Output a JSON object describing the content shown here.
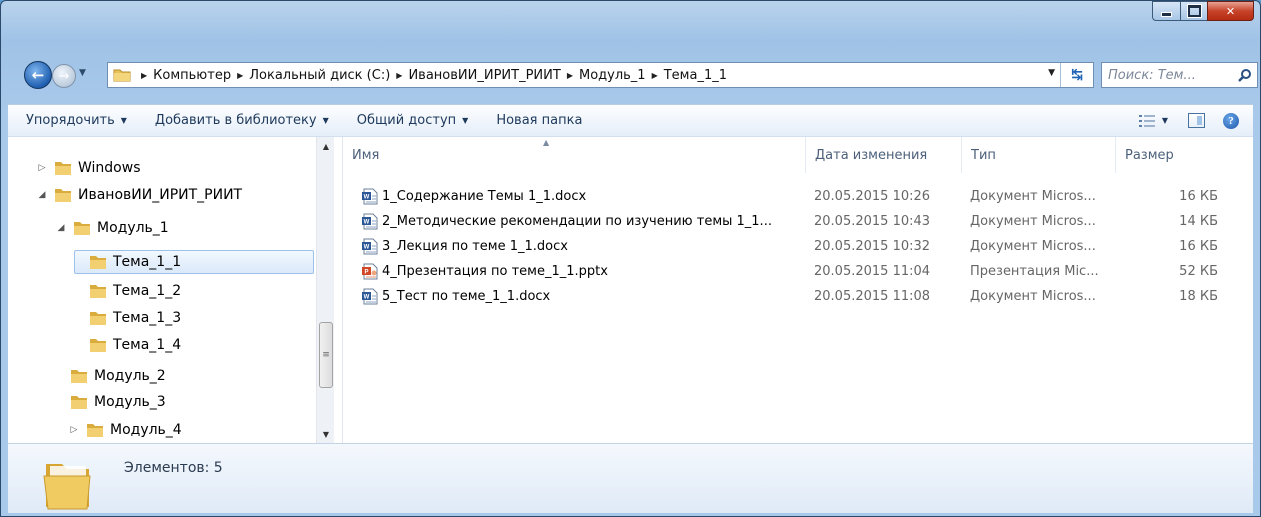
{
  "window": {
    "caption_buttons": {
      "minimize": "minimize",
      "maximize": "maximize",
      "close": "close"
    }
  },
  "address_bar": {
    "breadcrumbs": [
      "Компьютер",
      "Локальный диск (C:)",
      "ИвановИИ_ИРИТ_РИИТ",
      "Модуль_1",
      "Тема_1_1"
    ]
  },
  "search": {
    "placeholder": "Поиск: Тем..."
  },
  "toolbar": {
    "organize": "Упорядочить",
    "add_to_library": "Добавить в библиотеку",
    "share": "Общий доступ",
    "new_folder": "Новая папка"
  },
  "nav_tree": [
    {
      "label": "Windows",
      "expander": "▷"
    },
    {
      "label": "ИвановИИ_ИРИТ_РИИТ",
      "expander": "◢"
    },
    {
      "label": "Модуль_1",
      "expander": "◢"
    },
    {
      "label": "Тема_1_1",
      "expander": "",
      "selected": true
    },
    {
      "label": "Тема_1_2",
      "expander": ""
    },
    {
      "label": "Тема_1_3",
      "expander": ""
    },
    {
      "label": "Тема_1_4",
      "expander": ""
    },
    {
      "label": "Модуль_2",
      "expander": ""
    },
    {
      "label": "Модуль_3",
      "expander": ""
    },
    {
      "label": "Модуль_4",
      "expander": "▷"
    }
  ],
  "columns": {
    "name": "Имя",
    "date": "Дата изменения",
    "type": "Тип",
    "size": "Размер"
  },
  "files": [
    {
      "name": "1_Содержание Темы 1_1.docx",
      "date": "20.05.2015 10:26",
      "type": "Документ Micros...",
      "size": "16 КБ",
      "icon": "word-doc-icon"
    },
    {
      "name": "2_Методические рекомендации по изучению темы 1_1...",
      "date": "20.05.2015 10:43",
      "type": "Документ Micros...",
      "size": "14 КБ",
      "icon": "word-doc-icon"
    },
    {
      "name": "3_Лекция по теме 1_1.docx",
      "date": "20.05.2015 10:32",
      "type": "Документ Micros...",
      "size": "16 КБ",
      "icon": "word-doc-icon"
    },
    {
      "name": "4_Презентация по теме_1_1.pptx",
      "date": "20.05.2015 11:04",
      "type": "Презентация Mic...",
      "size": "52 КБ",
      "icon": "powerpoint-doc-icon"
    },
    {
      "name": "5_Тест по теме_1_1.docx",
      "date": "20.05.2015 11:08",
      "type": "Документ Micros...",
      "size": "18 КБ",
      "icon": "word-doc-icon"
    }
  ],
  "details": {
    "item_count": "Элементов: 5"
  },
  "colors": {
    "word": "#2b5797",
    "powerpoint": "#d24726",
    "folder": "#e8c15a",
    "selection": "#dbe9fa"
  }
}
